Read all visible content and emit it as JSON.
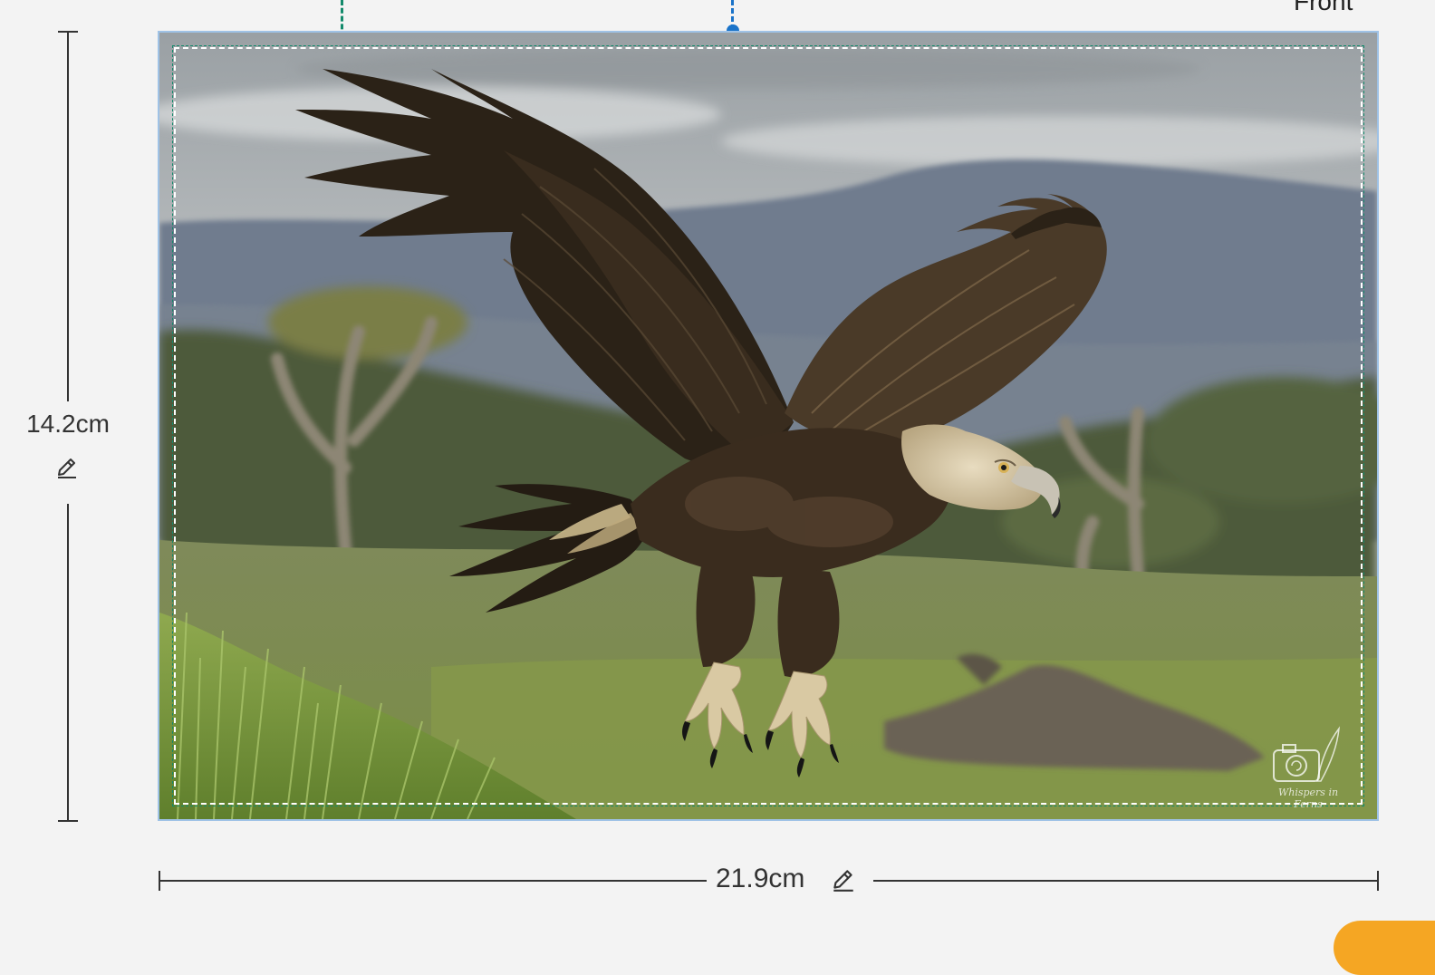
{
  "side_label": "Front",
  "dimensions": {
    "height_label": "14.2cm",
    "width_label": "21.9cm"
  },
  "watermark": {
    "text": "Whispers in Ferns"
  },
  "colors": {
    "safe_area_guide": "#138a6b",
    "center_guide": "#1a73c9",
    "canvas_border": "#9fc2e6",
    "action_button": "#f5a623"
  },
  "icons": {
    "edit": "pencil-icon"
  }
}
